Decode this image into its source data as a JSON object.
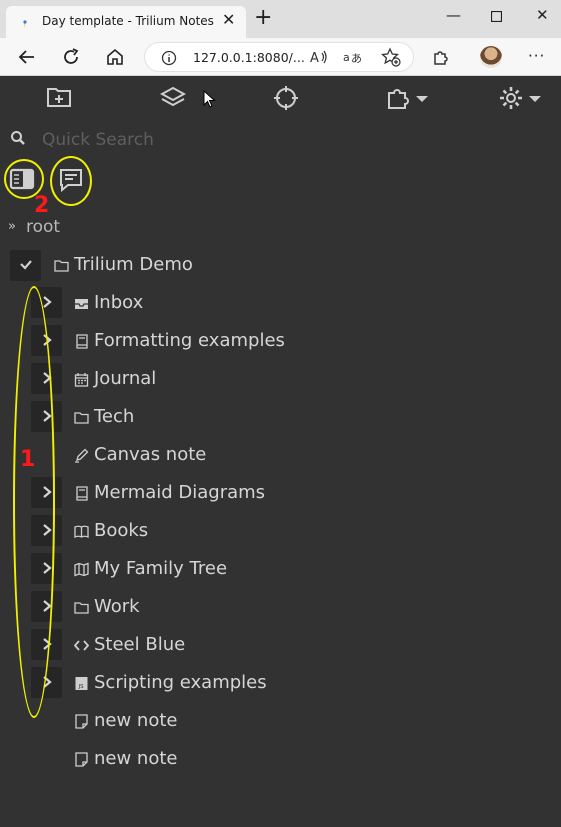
{
  "browser": {
    "tab_title": "Day template - Trilium Notes",
    "url": "127.0.0.1:8080/..."
  },
  "search": {
    "placeholder": "Quick Search"
  },
  "tree": {
    "root_label": "root",
    "top_note": "Trilium Demo",
    "children": [
      {
        "title": "Inbox",
        "icon": "inbox-icon",
        "expandable": true
      },
      {
        "title": "Formatting examples",
        "icon": "book-icon",
        "expandable": true
      },
      {
        "title": "Journal",
        "icon": "calendar-icon",
        "expandable": true
      },
      {
        "title": "Tech",
        "icon": "folder-icon",
        "expandable": true
      },
      {
        "title": "Canvas note",
        "icon": "pen-icon",
        "expandable": false
      },
      {
        "title": "Mermaid Diagrams",
        "icon": "book-icon",
        "expandable": true
      },
      {
        "title": "Books",
        "icon": "open-book-icon",
        "expandable": true
      },
      {
        "title": "My Family Tree",
        "icon": "map-icon",
        "expandable": true
      },
      {
        "title": "Work",
        "icon": "folder-icon",
        "expandable": true
      },
      {
        "title": "Steel Blue",
        "icon": "code-icon",
        "expandable": true
      },
      {
        "title": "Scripting examples",
        "icon": "js-file-icon",
        "expandable": true
      },
      {
        "title": "new note",
        "icon": "note-icon",
        "expandable": false
      },
      {
        "title": "new note",
        "icon": "note-icon",
        "expandable": false
      }
    ]
  },
  "annotations": {
    "label_1": "1",
    "label_2": "2"
  },
  "colors": {
    "annotation": "#f0f000",
    "annotation_number": "#ff1a1a",
    "sidebar_bg": "#323232",
    "text": "#d6d6d6"
  }
}
